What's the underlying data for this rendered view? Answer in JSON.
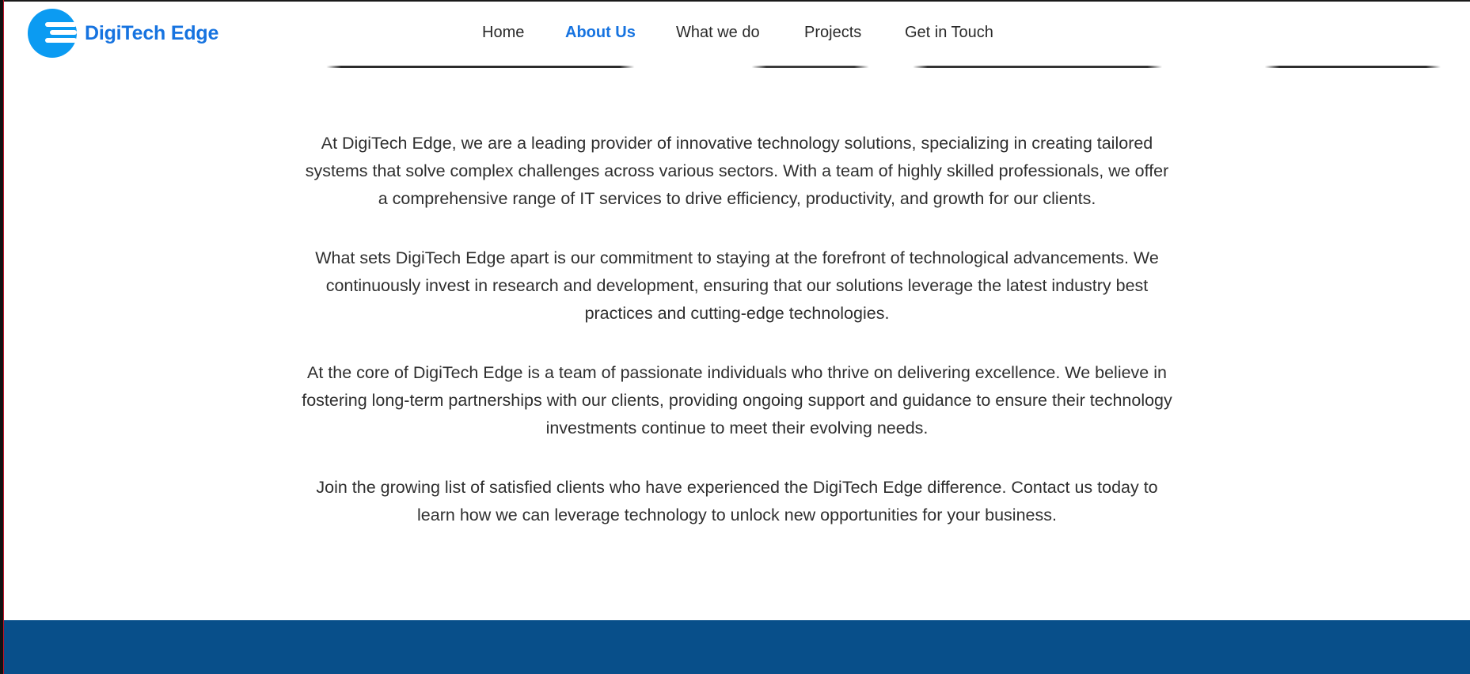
{
  "brand": {
    "name": "DigiTech Edge",
    "logo_icon": "digitech-edge-logo-icon",
    "color": "#1673e0",
    "logo_color": "#0b9bf2"
  },
  "nav": {
    "items": [
      {
        "label": "Home",
        "active": false
      },
      {
        "label": "About Us",
        "active": true
      },
      {
        "label": "What we do",
        "active": false
      },
      {
        "label": "Projects",
        "active": false
      },
      {
        "label": "Get in Touch",
        "active": false
      }
    ],
    "active_color": "#1673e0",
    "text_color": "#2a2a2a"
  },
  "about": {
    "paragraphs": [
      "At DigiTech Edge, we are a leading provider of innovative technology solutions, specializing in creating tailored systems that solve complex challenges across various sectors. With a team of highly skilled professionals, we offer a comprehensive range of IT services to drive efficiency, productivity, and growth for our clients.",
      "What sets DigiTech Edge apart is our commitment to staying at the forefront of technological advancements. We continuously invest in research and development, ensuring that our solutions leverage the latest industry best practices and cutting-edge technologies.",
      "At the core of DigiTech Edge is a team of passionate individuals who thrive on delivering excellence. We believe in fostering long-term partnerships with our clients, providing ongoing support and guidance to ensure their technology investments continue to meet their evolving needs.",
      "Join the growing list of satisfied clients who have experienced the DigiTech Edge difference. Contact us today to learn how we can leverage technology to unlock new opportunities for your business."
    ],
    "text_color": "#2f2f2f"
  },
  "footer": {
    "color": "#084f8a"
  }
}
